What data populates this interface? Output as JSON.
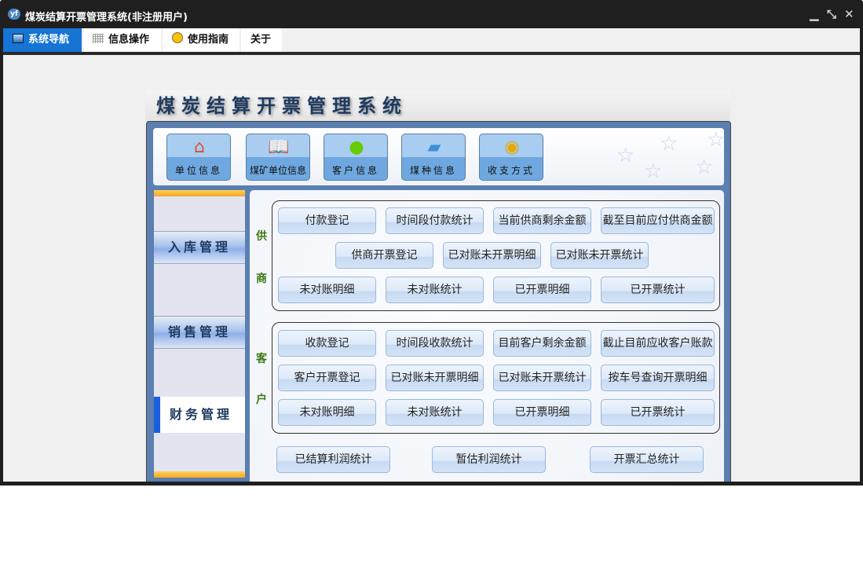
{
  "window": {
    "title": "煤炭结算开票管理系统(非注册用户)",
    "logo": "yf"
  },
  "menu": [
    {
      "label": "系统导航",
      "icon": "monitor-icon"
    },
    {
      "label": "信息操作",
      "icon": "grid-icon"
    },
    {
      "label": "使用指南",
      "icon": "help-icon"
    },
    {
      "label": "关于"
    }
  ],
  "header": {
    "title": "煤炭结算开票管理系统"
  },
  "toolbar": [
    {
      "label": "单位信息",
      "icon": "house-icon"
    },
    {
      "label": "煤矿单位信息",
      "icon": "book-icon"
    },
    {
      "label": "客户信息",
      "icon": "user-icon"
    },
    {
      "label": "煤种信息",
      "icon": "folder-icon"
    },
    {
      "label": "收支方式",
      "icon": "coins-icon"
    }
  ],
  "nav": [
    {
      "label": "入库管理"
    },
    {
      "label": "销售管理"
    },
    {
      "label": "财务管理",
      "selected": true
    }
  ],
  "supplier": {
    "label1": "供",
    "label2": "商",
    "row1": [
      "付款登记",
      "时间段付款统计",
      "当前供商剩余金额",
      "截至目前应付供商金额"
    ],
    "row2": [
      "供商开票登记",
      "已对账未开票明细",
      "已对账未开票统计"
    ],
    "row3": [
      "未对账明细",
      "未对账统计",
      "已开票明细",
      "已开票统计"
    ]
  },
  "customer": {
    "label1": "客",
    "label2": "户",
    "row1": [
      "收款登记",
      "时间段收款统计",
      "目前客户剩余金额",
      "截止目前应收客户账款"
    ],
    "row2": [
      "客户开票登记",
      "已对账未开票明细",
      "已对账未开票统计",
      "按车号查询开票明细"
    ],
    "row3": [
      "未对账明细",
      "未对账统计",
      "已开票明细",
      "已开票统计"
    ]
  },
  "bottom": [
    "已结算利润统计",
    "暂估利润统计",
    "开票汇总统计"
  ]
}
